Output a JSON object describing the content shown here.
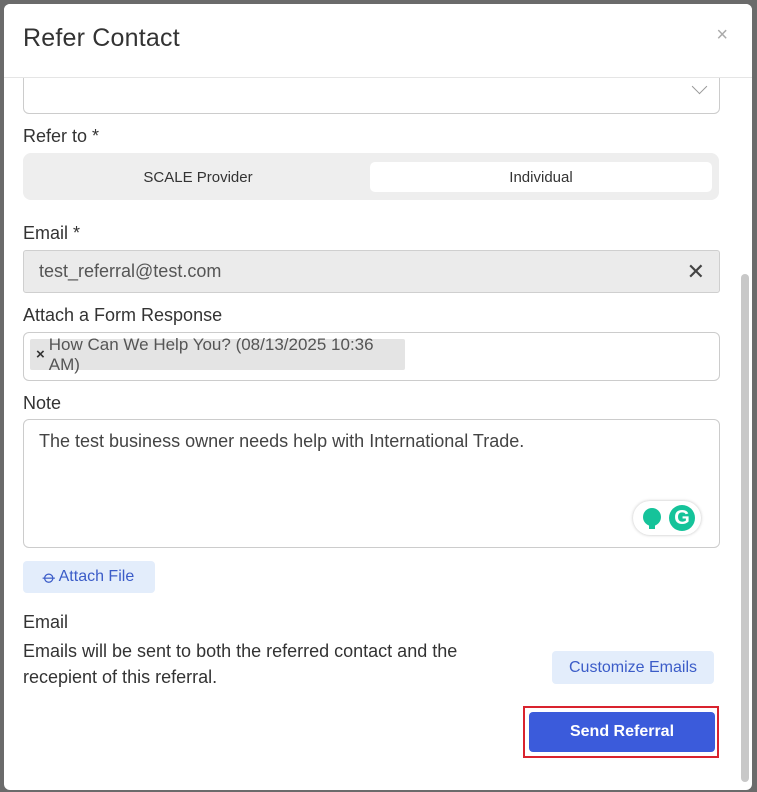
{
  "modal": {
    "title": "Refer Contact",
    "close_glyph": "×"
  },
  "refer_to": {
    "label": "Refer to *",
    "options": [
      "SCALE Provider",
      "Individual"
    ],
    "selected": "Individual"
  },
  "email_field": {
    "label": "Email *",
    "value": "test_referral@test.com",
    "clear_glyph": "✕"
  },
  "form_response": {
    "label": "Attach a Form Response",
    "chip_remove": "×",
    "chip_text": "How Can We Help You? (08/13/2025 10:36 AM)"
  },
  "note": {
    "label": "Note",
    "value": "The test business owner needs help with International Trade."
  },
  "grammarly": {
    "letter": "G",
    "icons": [
      "lightbulb-icon",
      "grammarly-icon"
    ]
  },
  "attach_file": {
    "label": "Attach File",
    "icon": "paperclip-icon"
  },
  "email_section": {
    "heading": "Email",
    "description_line1": "Emails will be sent to both the referred contact and the",
    "description_line2": "recepient of this referral.",
    "customize_label": "Customize Emails"
  },
  "send": {
    "label": "Send Referral"
  },
  "colors": {
    "primary": "#3b5bdb",
    "highlight": "#d9232e",
    "grammarly": "#15c39a"
  }
}
